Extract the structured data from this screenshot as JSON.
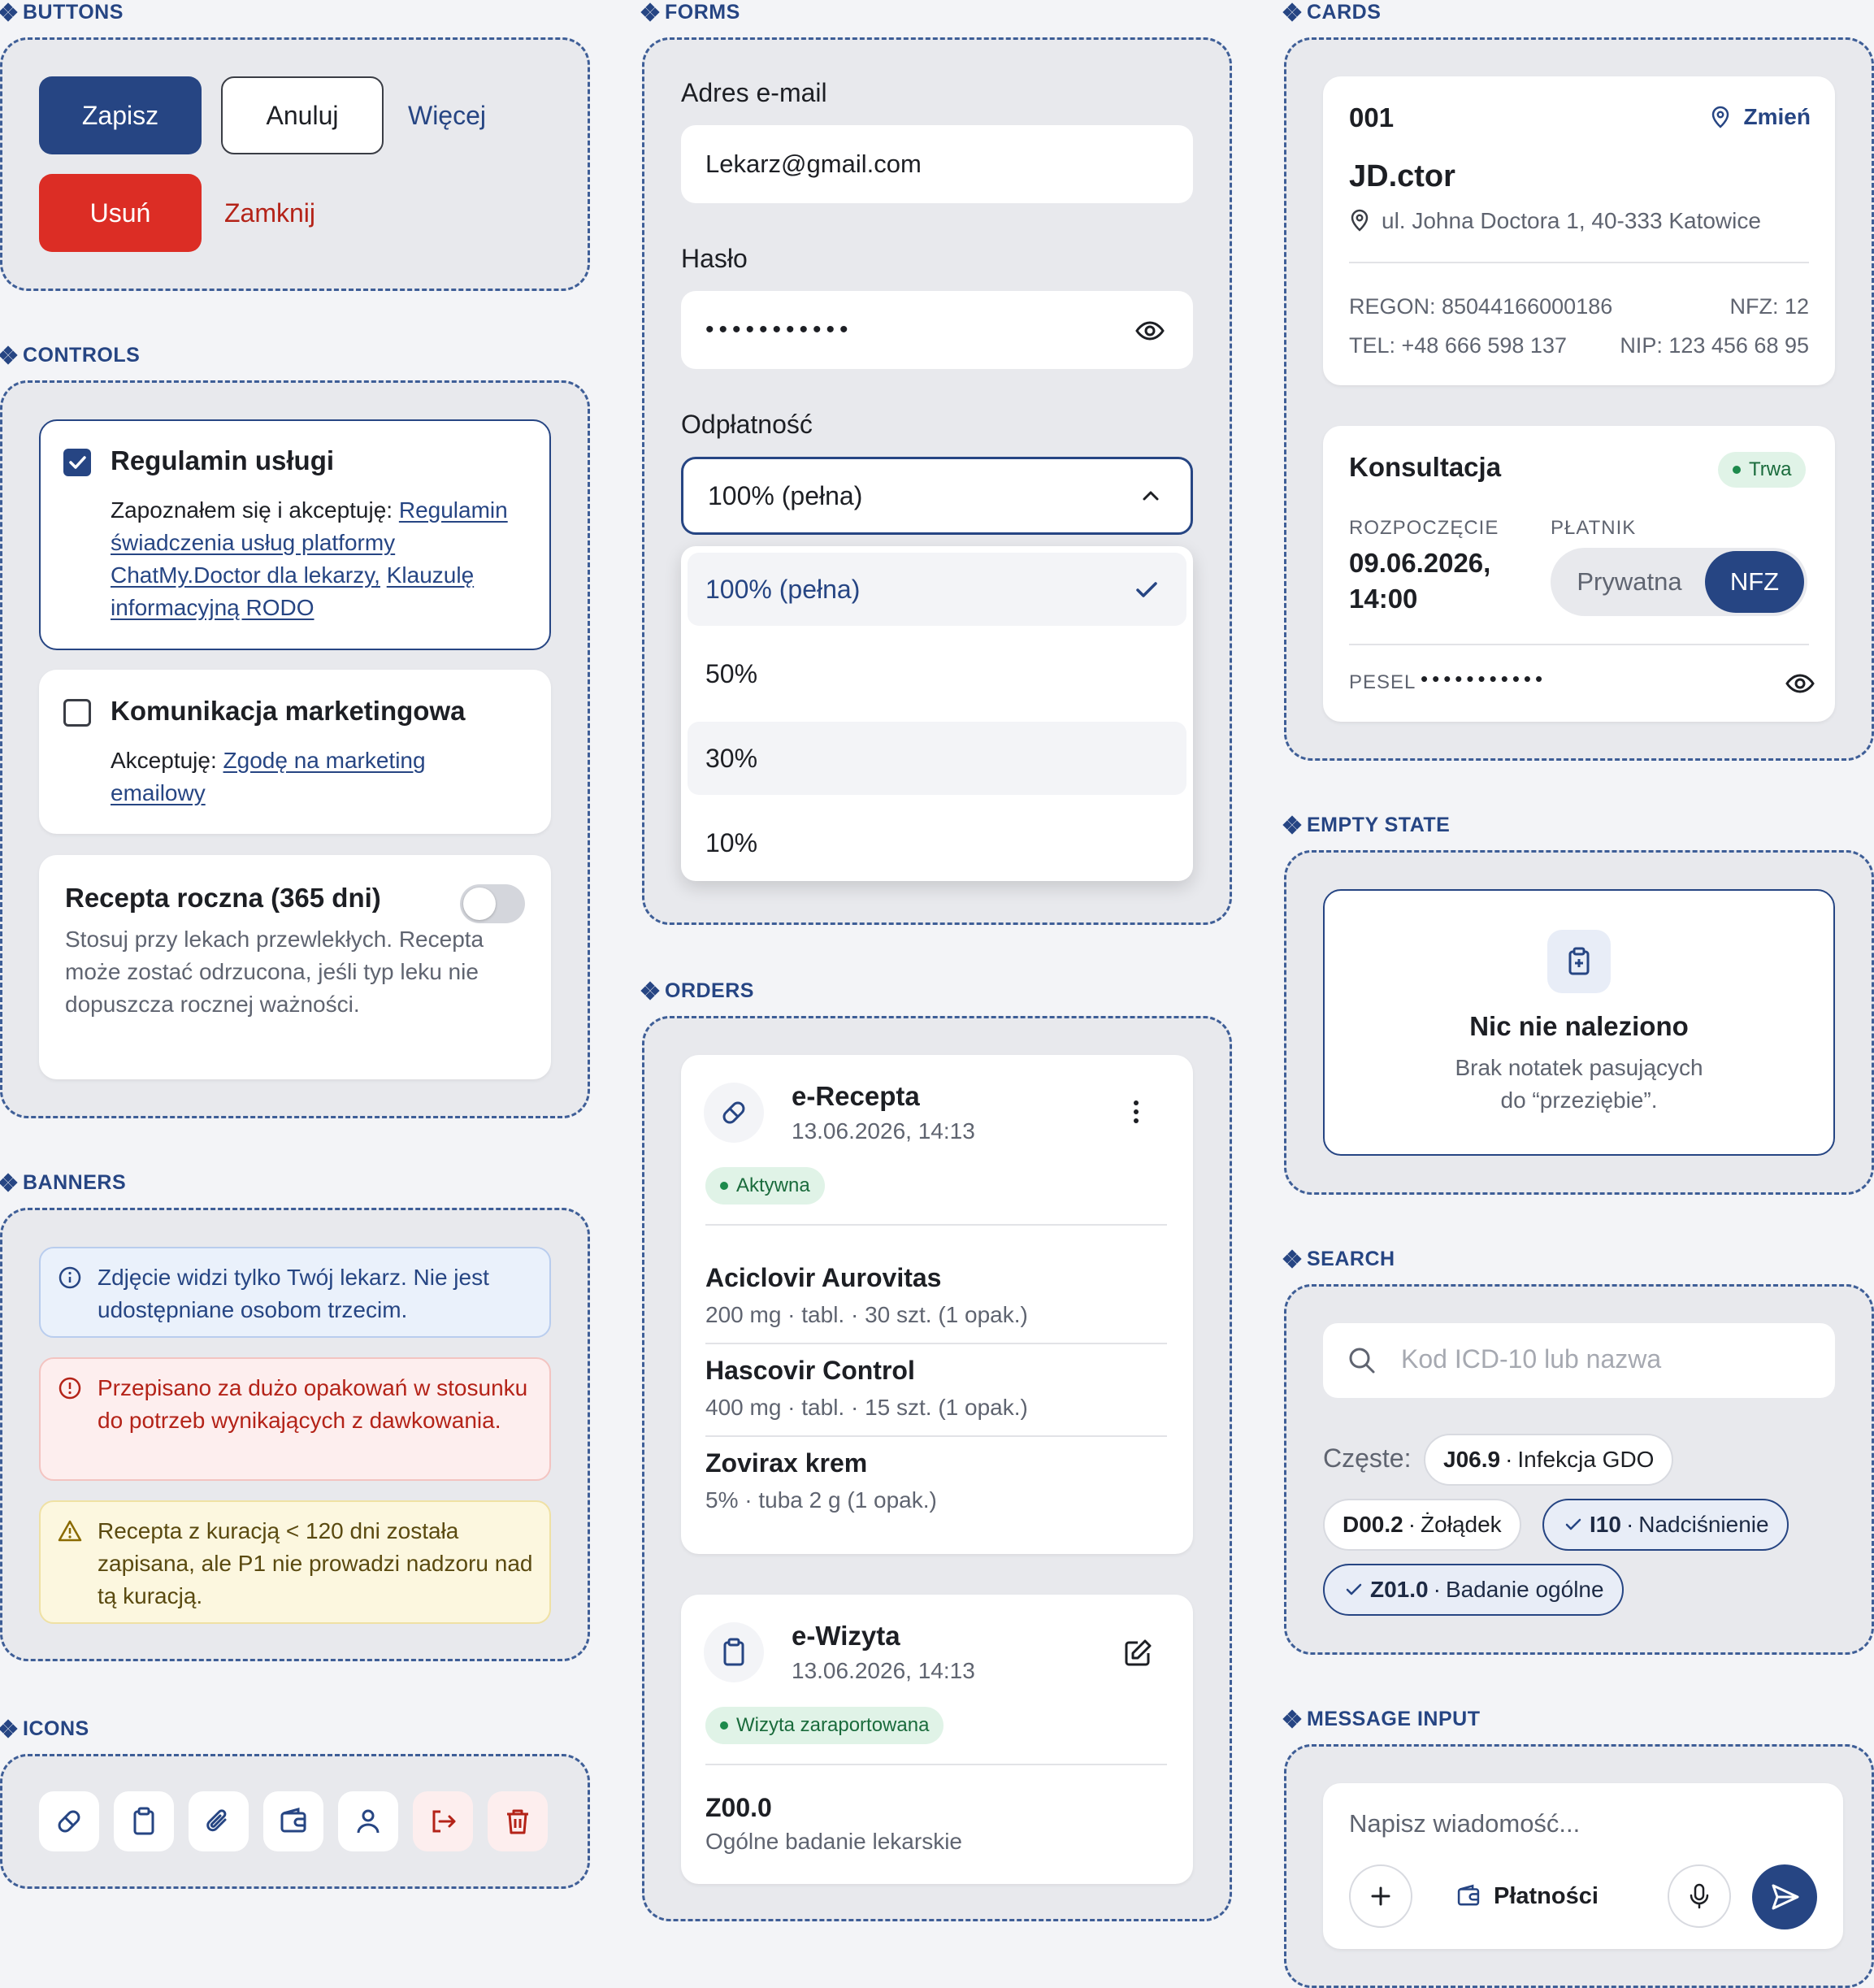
{
  "sections": {
    "buttons": "BUTTONS",
    "forms": "FORMS",
    "cards": "CARDS",
    "controls": "CONTROLS",
    "empty_state": "EMPTY STATE",
    "orders": "ORDERS",
    "banners": "BANNERS",
    "search": "SEARCH",
    "icons": "ICONS",
    "message_input": "MESSAGE INPUT"
  },
  "buttons": {
    "save": "Zapisz",
    "cancel": "Anuluj",
    "more": "Więcej",
    "delete": "Usuń",
    "close": "Zamknij"
  },
  "forms": {
    "email_label": "Adres e-mail",
    "email_value": "Lekarz@gmail.com",
    "password_label": "Hasło",
    "password_value": "•••••••••••",
    "payment_label": "Odpłatność",
    "payment_selected": "100% (pełna)",
    "options": [
      "100% (pełna)",
      "50%",
      "30%",
      "10%"
    ]
  },
  "clinic_card": {
    "number": "001",
    "change": "Zmień",
    "name": "JD.ctor",
    "address": "ul. Johna Doctora 1, 40-333 Katowice",
    "regon": "REGON: 85044166000186",
    "nfz": "NFZ: 12",
    "tel": "TEL: +48 666 598 137",
    "nip": "NIP: 123 456 68 95"
  },
  "visit_card": {
    "title": "Konsultacja",
    "status": "Trwa",
    "start_label": "ROZPOCZĘCIE",
    "start_date": "09.06.2026,",
    "start_time": "14:00",
    "payer_label": "PŁATNIK",
    "payer_private": "Prywatna",
    "payer_nfz": "NFZ",
    "pesel_label": "PESEL",
    "pesel_value": "•••••••••••"
  },
  "controls": {
    "terms_title": "Regulamin usługi",
    "terms_prefix": "Zapoznałem się i akceptuję: ",
    "terms_link1": "Regulamin świadczenia usług platformy ChatMy.Doctor dla lekarzy,",
    "terms_link2": "Klauzulę informacyjną RODO",
    "terms_checked": true,
    "marketing_title": "Komunikacja marketingowa",
    "marketing_prefix": "Akceptuję: ",
    "marketing_link": "Zgodę na marketing emailowy",
    "marketing_checked": false,
    "annual_title": "Recepta roczna (365 dni)",
    "annual_desc": "Stosuj przy lekach przewlekłych. Recepta może zostać odrzucona, jeśli typ leku nie dopuszcza rocznej ważności.",
    "annual_enabled": false
  },
  "empty_state": {
    "title": "Nic nie naleziono",
    "line1": "Brak notatek pasujących",
    "line2": "do “przeziębie”."
  },
  "orders": {
    "prescription": {
      "title": "e-Recepta",
      "date": "13.06.2026, 14:13",
      "status": "Aktywna",
      "items": [
        {
          "name": "Aciclovir Aurovitas",
          "detail": "200 mg · tabl. · 30 szt. (1 opak.)"
        },
        {
          "name": "Hascovir Control",
          "detail": "400 mg · tabl. · 15 szt. (1 opak.)"
        },
        {
          "name": "Zovirax krem",
          "detail": "5% · tuba 2 g (1 opak.)"
        }
      ]
    },
    "visit": {
      "title": "e-Wizyta",
      "date": "13.06.2026, 14:13",
      "status": "Wizyta zaraportowana",
      "code": "Z00.0",
      "desc": "Ogólne badanie lekarskie"
    }
  },
  "banners": {
    "info": "Zdjęcie widzi tylko Twój lekarz. Nie jest udostępniane osobom trzecim.",
    "error": "Przepisano za dużo opakowań w stosunku do potrzeb wynikających z dawkowania.",
    "warning": "Recepta z kuracją < 120 dni została zapisana, ale P1 nie prowadzi nadzoru nad tą kuracją."
  },
  "search": {
    "placeholder": "Kod ICD-10 lub nazwa",
    "frequent_label": "Częste:",
    "chips": [
      {
        "code": "J06.9",
        "name": "Infekcja GDO",
        "selected": false
      },
      {
        "code": "D00.2",
        "name": "Żołądek",
        "selected": false
      },
      {
        "code": "I10",
        "name": "Nadciśnienie",
        "selected": true
      },
      {
        "code": "Z01.0",
        "name": "Badanie ogólne",
        "selected": true
      }
    ],
    "separator": " · "
  },
  "icons": [
    "pill-icon",
    "clipboard-icon",
    "paperclip-icon",
    "wallet-icon",
    "user-icon",
    "logout-icon",
    "trash-icon"
  ],
  "message": {
    "placeholder": "Napisz wiadomość...",
    "payments": "Płatności"
  },
  "colors": {
    "primary": "#264583",
    "danger": "#dc2d25",
    "danger_text": "#b42318",
    "success": "#1d8a4c",
    "panel": "#e8e9ed"
  }
}
